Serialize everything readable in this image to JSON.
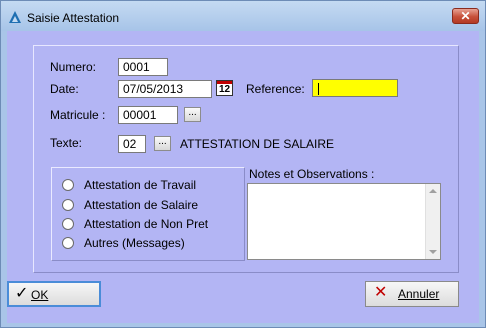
{
  "window": {
    "title": "Saisie Attestation",
    "close_glyph": "✕"
  },
  "form": {
    "numero_label": "Numero:",
    "numero_value": "0001",
    "date_label": "Date:",
    "date_value": "07/05/2013",
    "calendar_text": "12",
    "reference_label": "Reference:",
    "reference_value": "",
    "matricule_label": "Matricule :",
    "matricule_value": "00001",
    "texte_label": "Texte:",
    "texte_value": "02",
    "texte_description": "ATTESTATION DE SALAIRE",
    "browse_label": "..."
  },
  "radio_options": [
    "Attestation de Travail",
    "Attestation de Salaire",
    "Attestation de Non Pret",
    "Autres (Messages)"
  ],
  "notes": {
    "label": "Notes et Observations :",
    "value": ""
  },
  "buttons": {
    "ok_label": "OK",
    "ok_glyph": "✓",
    "cancel_label": "Annuler",
    "cancel_glyph": "✕"
  },
  "colors": {
    "client_bg": "#b3b5f4",
    "reference_bg": "#ffff00",
    "close_button": "#c7503a",
    "cancel_icon": "#c00000"
  }
}
